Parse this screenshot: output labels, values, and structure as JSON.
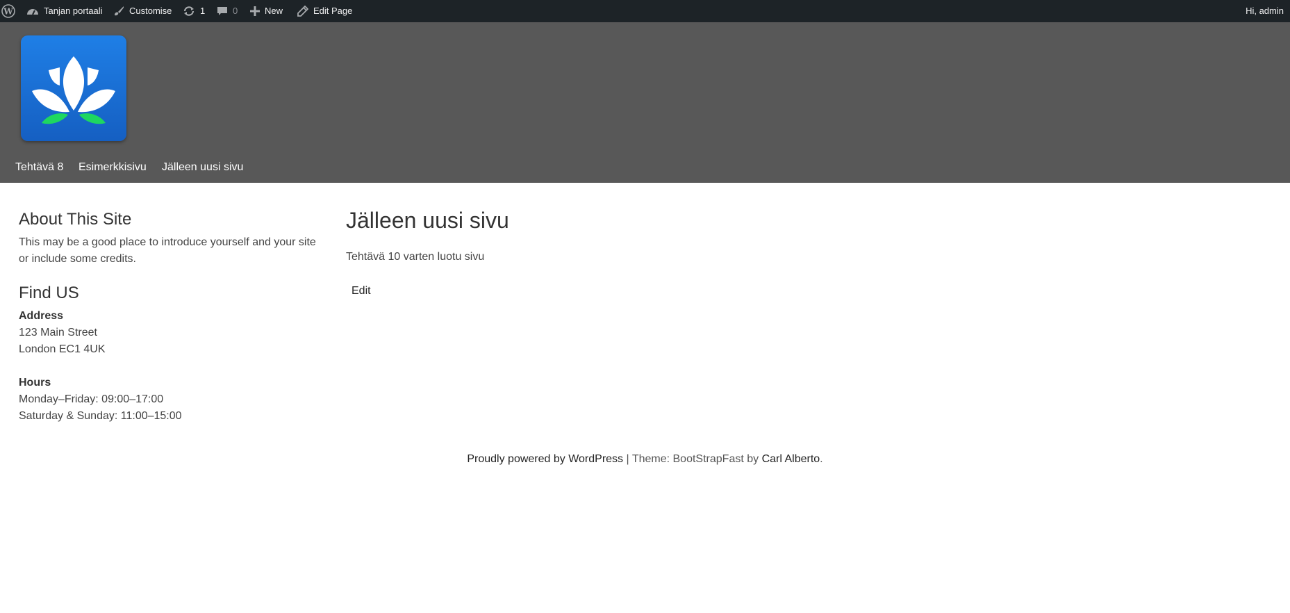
{
  "admin_bar": {
    "site_name": "Tanjan portaali",
    "customise": "Customise",
    "updates_count": "1",
    "comments_count": "0",
    "new": "New",
    "edit_page": "Edit Page",
    "greeting": "Hi, admin"
  },
  "nav": {
    "items": [
      "Tehtävä 8",
      "Esimerkkisivu",
      "Jälleen uusi sivu"
    ]
  },
  "sidebar": {
    "about_title": "About This Site",
    "about_text": "This may be a good place to introduce yourself and your site or include some credits.",
    "find_title": "Find US",
    "address_label": "Address",
    "address_line1": "123 Main Street",
    "address_line2": "London EC1 4UK",
    "hours_label": "Hours",
    "hours_line1": "Monday–Friday: 09:00–17:00",
    "hours_line2": "Saturday & Sunday: 11:00–15:00"
  },
  "main": {
    "title": "Jälleen uusi sivu",
    "body": "Tehtävä 10 varten luotu sivu",
    "edit": "Edit"
  },
  "footer": {
    "powered": "Proudly powered by WordPress",
    "separator": " | Theme: BootStrapFast by ",
    "author": "Carl Alberto",
    "end": "."
  },
  "colors": {
    "admin_bar": "#1d2327",
    "header": "#585858",
    "logo_blue": "#1a6fd6",
    "leaf_green": "#1ed760"
  },
  "icons": [
    "wordpress-icon",
    "dashboard-icon",
    "brush-icon",
    "updates-icon",
    "comment-icon",
    "plus-icon",
    "pencil-icon"
  ]
}
